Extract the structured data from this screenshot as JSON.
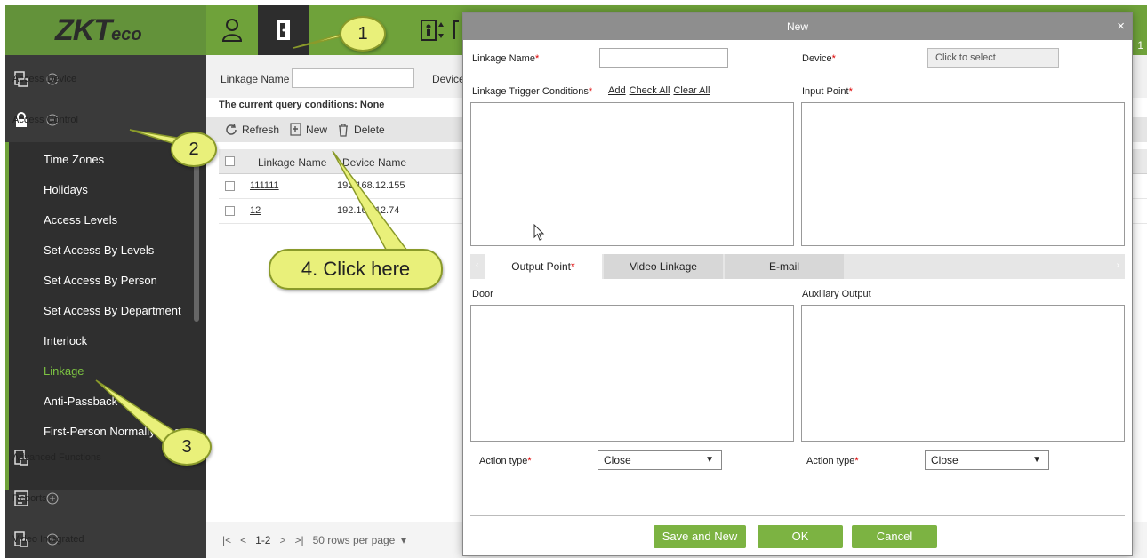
{
  "brand": {
    "logo_main": "ZKT",
    "logo_sub": "eco"
  },
  "topbar": {
    "right_text": "1"
  },
  "sidebar": {
    "sections": [
      {
        "label": "Access Device"
      },
      {
        "label": "Access Control"
      },
      {
        "label": "Advanced Functions"
      },
      {
        "label": "Reports"
      },
      {
        "label": "Video Integrated"
      }
    ],
    "items": [
      {
        "label": "Time Zones"
      },
      {
        "label": "Holidays"
      },
      {
        "label": "Access Levels"
      },
      {
        "label": "Set Access By Levels"
      },
      {
        "label": "Set Access By Person"
      },
      {
        "label": "Set Access By Department"
      },
      {
        "label": "Interlock"
      },
      {
        "label": "Linkage"
      },
      {
        "label": "Anti-Passback"
      },
      {
        "label": "First-Person Normally Open"
      }
    ]
  },
  "main": {
    "filter_label": "Linkage Name",
    "filter_label2": "Device",
    "query_text": "The current query conditions: None",
    "toolbar": {
      "refresh": "Refresh",
      "new": "New",
      "delete": "Delete"
    },
    "columns": [
      "Linkage Name",
      "Device Name"
    ],
    "rows": [
      {
        "name": "111111",
        "device": "192.168.12.155"
      },
      {
        "name": "12",
        "device": "192.168.12.74"
      }
    ],
    "pager": {
      "range": "1-2",
      "rows_per_page": "50 rows per page"
    }
  },
  "dialog": {
    "title": "New",
    "close": "×",
    "linkage_name_label": "Linkage Name",
    "device_label": "Device",
    "device_placeholder": "Click to select",
    "trigger_label": "Linkage Trigger Conditions",
    "trigger_links": {
      "add": "Add",
      "check_all": "Check All",
      "clear_all": "Clear All"
    },
    "input_point_label": "Input Point",
    "tabs": [
      "Output Point",
      "Video Linkage",
      "E-mail"
    ],
    "door_label": "Door",
    "aux_label": "Auxiliary Output",
    "action_type_label": "Action type",
    "action_left": "Close",
    "action_right": "Close",
    "buttons": {
      "save_new": "Save and New",
      "ok": "OK",
      "cancel": "Cancel"
    }
  },
  "callouts": {
    "one": "1",
    "two": "2",
    "three": "3",
    "four": "4. Click here"
  },
  "colors": {
    "accent": "#6fa23a",
    "button": "#7cb342",
    "callout": "#e9f07a",
    "sidebar": "#3a3a3a",
    "active_item": "#7cc242"
  }
}
